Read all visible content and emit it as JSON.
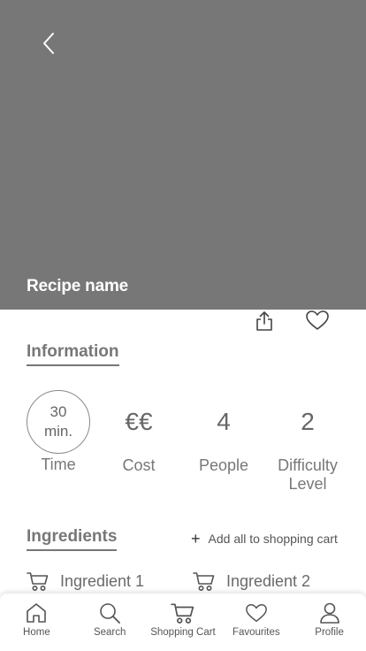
{
  "hero": {
    "title": "Recipe name",
    "background": "#777777"
  },
  "icons": {
    "back": "chevron-left-icon",
    "share": "share-icon",
    "favourite": "heart-icon",
    "cart": "cart-icon"
  },
  "information": {
    "title": "Information",
    "stats": [
      {
        "value": "30 min.",
        "label": "Time"
      },
      {
        "value": "€€",
        "label": "Cost"
      },
      {
        "value": "4",
        "label": "People"
      },
      {
        "value": "2",
        "label": "Difficulty Level"
      }
    ]
  },
  "ingredients": {
    "title": "Ingredients",
    "add_all": "Add all to shopping cart",
    "items": [
      "Ingredient 1",
      "Ingredient 2"
    ]
  },
  "tabbar": {
    "tabs": [
      {
        "label": "Home",
        "icon": "home-icon"
      },
      {
        "label": "Search",
        "icon": "search-icon"
      },
      {
        "label": "Shopping Cart",
        "icon": "cart-icon"
      },
      {
        "label": "Favourites",
        "icon": "heart-icon"
      },
      {
        "label": "Profile",
        "icon": "user-icon"
      }
    ]
  }
}
